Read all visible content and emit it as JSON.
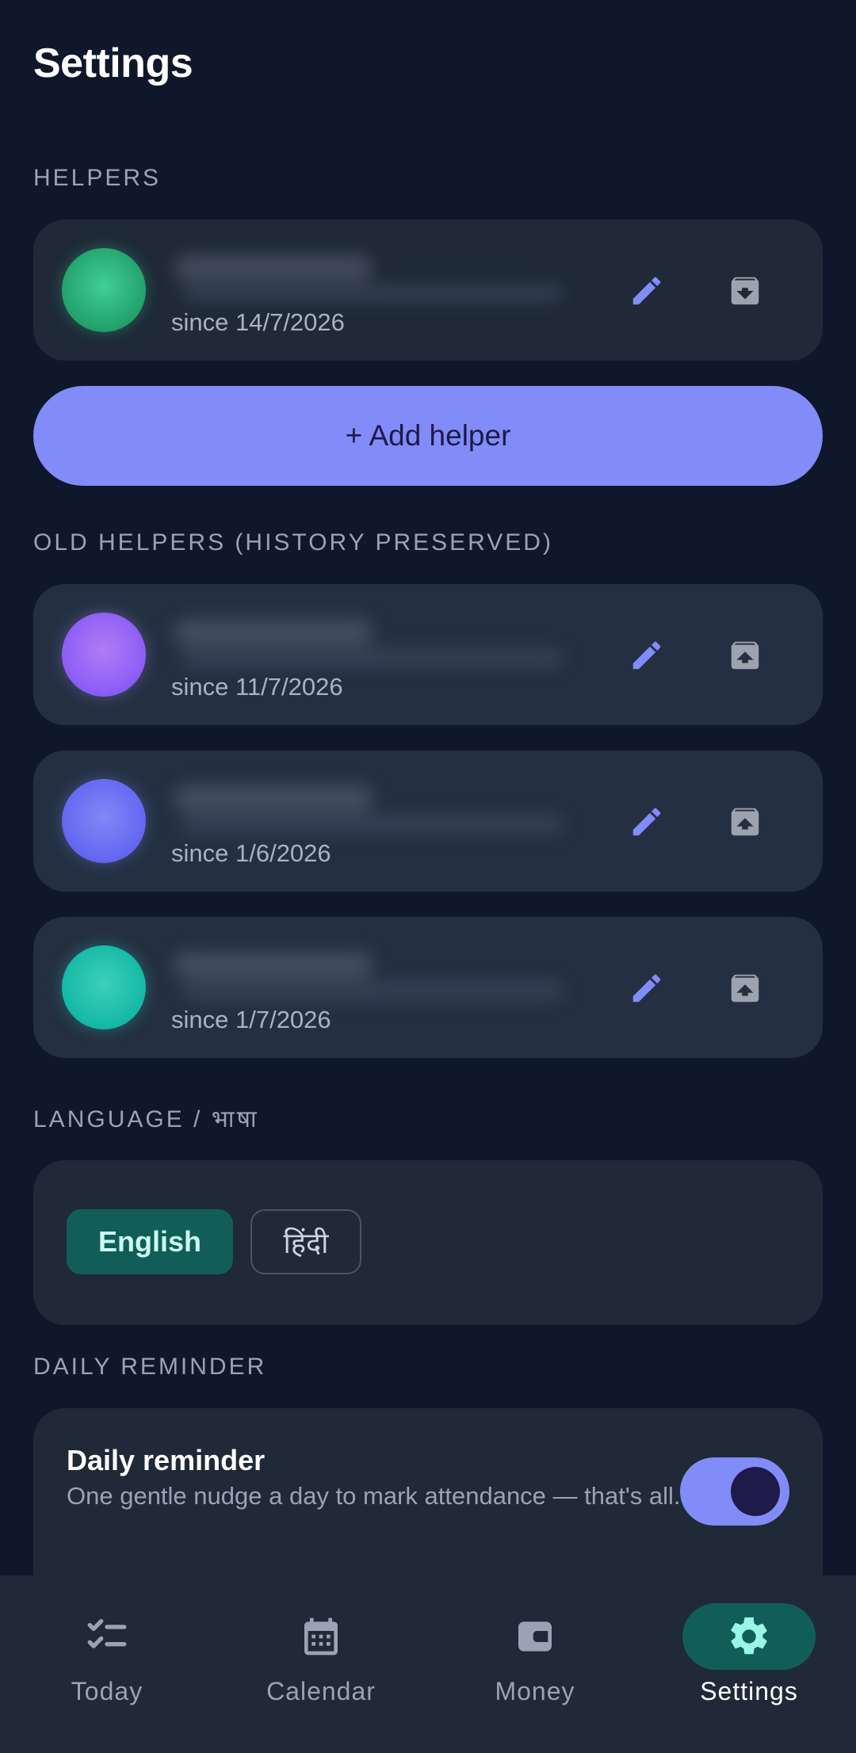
{
  "header": {
    "title": "Settings"
  },
  "helpers_section": {
    "label": "HELPERS",
    "items": [
      {
        "since": "since 14/7/2026",
        "avatar_color": "#34d399"
      }
    ]
  },
  "add_helper": {
    "label": "+ Add helper"
  },
  "old_helpers_section": {
    "label": "OLD HELPERS (HISTORY PRESERVED)",
    "items": [
      {
        "since": "since 11/7/2026",
        "avatar_color": "#a78bfa"
      },
      {
        "since": "since 1/6/2026",
        "avatar_color": "#7c83f0"
      },
      {
        "since": "since 1/7/2026",
        "avatar_color": "#2dd4bf"
      }
    ]
  },
  "language_section": {
    "label": "LANGUAGE / भाषा",
    "options": [
      {
        "label": "English",
        "selected": true
      },
      {
        "label": "हिंदी",
        "selected": false
      }
    ]
  },
  "reminder_section": {
    "label": "DAILY REMINDER",
    "title": "Daily reminder",
    "description": "One gentle nudge a day to mark attendance — that's all.",
    "enabled": true
  },
  "bottom_nav": {
    "items": [
      {
        "label": "Today",
        "icon": "checklist-icon"
      },
      {
        "label": "Calendar",
        "icon": "calendar-icon"
      },
      {
        "label": "Money",
        "icon": "wallet-icon"
      },
      {
        "label": "Settings",
        "icon": "gear-icon",
        "active": true
      }
    ]
  },
  "colors": {
    "background": "#0f172a",
    "card": "#1f2937",
    "accent": "#818cf8",
    "active_green": "#115e59"
  }
}
